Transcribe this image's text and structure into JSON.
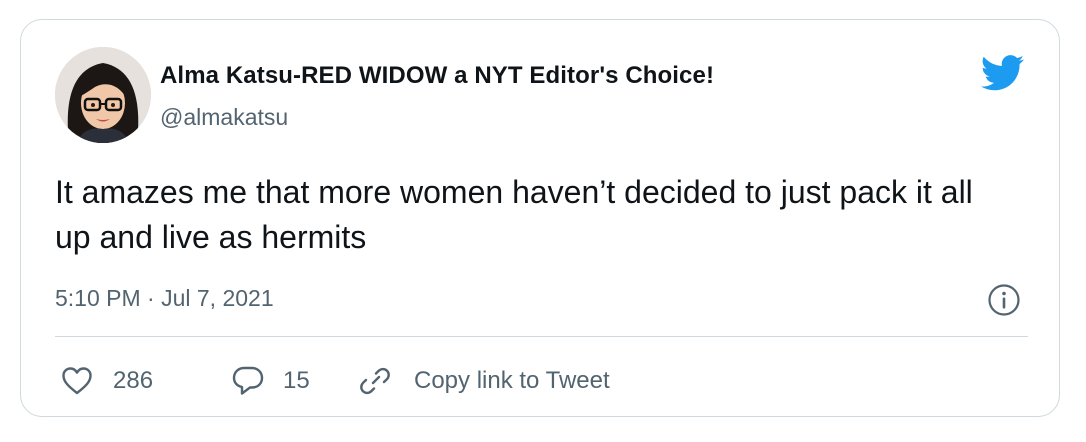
{
  "author": {
    "display_name": "Alma Katsu-RED WIDOW a NYT Editor's Choice!",
    "handle": "@almakatsu",
    "avatar_icon": "avatar-illustration"
  },
  "tweet": {
    "text": "It amazes me that more women haven’t decided to just pack it all up and live as hermits",
    "timestamp": "5:10 PM · Jul 7, 2021"
  },
  "actions": {
    "likes": "286",
    "replies": "15",
    "copy_link_label": "Copy link to Tweet"
  },
  "icons": {
    "brand": "twitter-bird-icon",
    "info": "info-icon",
    "like": "heart-icon",
    "reply": "speech-bubble-icon",
    "link": "link-icon"
  },
  "colors": {
    "brand_blue": "#1d9bf0",
    "text_primary": "#0f1419",
    "text_secondary": "#536471",
    "border": "#cfd9de"
  }
}
